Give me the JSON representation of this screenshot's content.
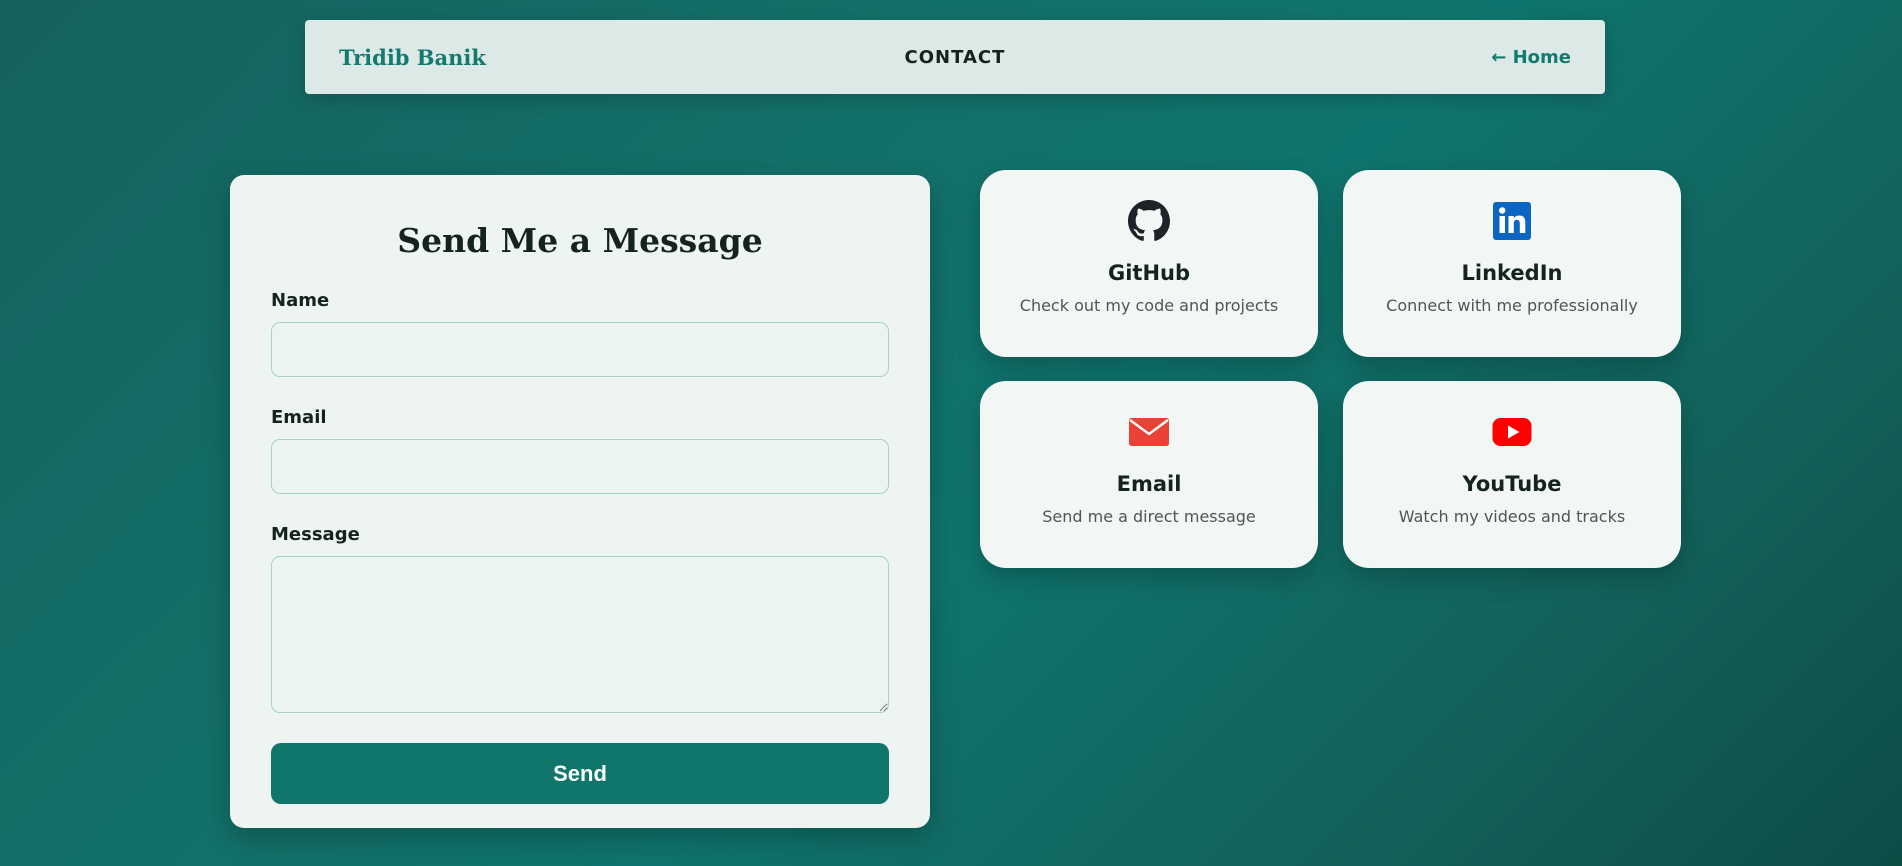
{
  "navbar": {
    "brand": "Tridib Banik",
    "title": "CONTACT",
    "home_link": "← Home"
  },
  "form": {
    "title": "Send Me a Message",
    "name_label": "Name",
    "name_value": "",
    "email_label": "Email",
    "email_value": "",
    "message_label": "Message",
    "message_value": "",
    "send_label": "Send"
  },
  "cards": [
    {
      "icon": "github-icon",
      "title": "GitHub",
      "description": "Check out my code and projects"
    },
    {
      "icon": "linkedin-icon",
      "title": "LinkedIn",
      "description": "Connect with me professionally"
    },
    {
      "icon": "email-icon",
      "title": "Email",
      "description": "Send me a direct message"
    },
    {
      "icon": "youtube-icon",
      "title": "YouTube",
      "description": "Watch my videos and tracks"
    }
  ],
  "colors": {
    "accent": "#10756b",
    "background": "#137068",
    "linkedin": "#0a66c2",
    "email": "#ea4335",
    "youtube": "#ff0000",
    "github": "#1f2328"
  }
}
